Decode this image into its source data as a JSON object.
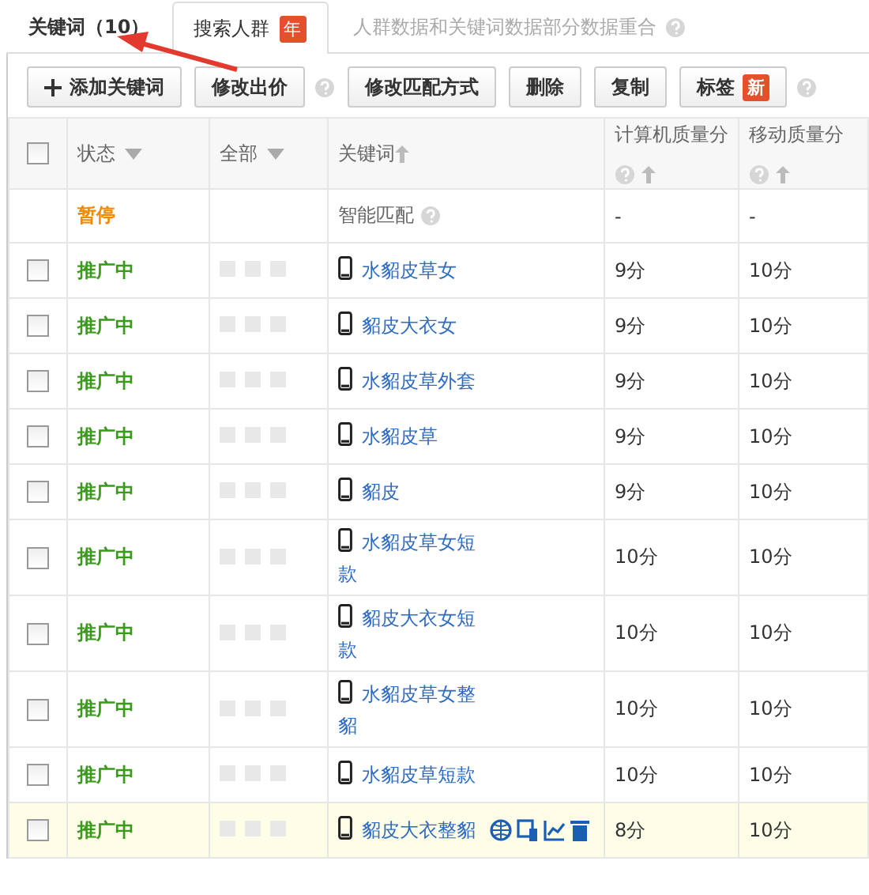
{
  "tabs": [
    {
      "label": "关键词（10）",
      "selected": true
    },
    {
      "label": "搜索人群",
      "badge": "年",
      "selected": false
    }
  ],
  "tab_note": "人群数据和关键词数据部分数据重合",
  "toolbar": [
    {
      "label": "添加关键词",
      "kind": "add",
      "help": false
    },
    {
      "label": "修改出价",
      "kind": "plain",
      "help": true
    },
    {
      "label": "修改匹配方式",
      "kind": "plain",
      "help": false
    },
    {
      "label": "删除",
      "kind": "plain",
      "help": false
    },
    {
      "label": "复制",
      "kind": "plain",
      "help": false
    },
    {
      "label": "标签",
      "kind": "plain",
      "badge": "新",
      "help": true
    }
  ],
  "table": {
    "select_all": {
      "checked": false
    },
    "columns": [
      {
        "label": "状态",
        "kind": "dropdown"
      },
      {
        "label": "全部",
        "kind": "dropdown"
      },
      {
        "label": "关键词",
        "kind": "sort"
      },
      {
        "label": "计算机质量分",
        "kind": "help-sort"
      },
      {
        "label": "移动质量分",
        "kind": "help-sort"
      }
    ],
    "smart_row": {
      "status": "暂停",
      "color": "#f08a00",
      "keyword": "智能匹配",
      "pc_score": "-",
      "mobile_score": "-"
    },
    "rows": [
      {
        "checked": false,
        "status": "推广中",
        "color": "#3a9a1c",
        "keyword": "水貂皮草女",
        "pc_score": "9分",
        "mobile_score": "10分",
        "highlighted": false
      },
      {
        "checked": false,
        "status": "推广中",
        "color": "#3a9a1c",
        "keyword": "貂皮大衣女",
        "pc_score": "9分",
        "mobile_score": "10分",
        "highlighted": false
      },
      {
        "checked": false,
        "status": "推广中",
        "color": "#3a9a1c",
        "keyword": "水貂皮草外套",
        "pc_score": "9分",
        "mobile_score": "10分",
        "highlighted": false
      },
      {
        "checked": false,
        "status": "推广中",
        "color": "#3a9a1c",
        "keyword": "水貂皮草",
        "pc_score": "9分",
        "mobile_score": "10分",
        "highlighted": false
      },
      {
        "checked": false,
        "status": "推广中",
        "color": "#3a9a1c",
        "keyword": "貂皮",
        "pc_score": "9分",
        "mobile_score": "10分",
        "highlighted": false
      },
      {
        "checked": false,
        "status": "推广中",
        "color": "#3a9a1c",
        "keyword": "水貂皮草女短款",
        "pc_score": "10分",
        "mobile_score": "10分",
        "highlighted": false
      },
      {
        "checked": false,
        "status": "推广中",
        "color": "#3a9a1c",
        "keyword": "貂皮大衣女短款",
        "pc_score": "10分",
        "mobile_score": "10分",
        "highlighted": false
      },
      {
        "checked": false,
        "status": "推广中",
        "color": "#3a9a1c",
        "keyword": "水貂皮草女整貂",
        "pc_score": "10分",
        "mobile_score": "10分",
        "highlighted": false
      },
      {
        "checked": false,
        "status": "推广中",
        "color": "#3a9a1c",
        "keyword": "水貂皮草短款",
        "pc_score": "10分",
        "mobile_score": "10分",
        "highlighted": false
      },
      {
        "checked": false,
        "status": "推广中",
        "color": "#3a9a1c",
        "keyword": "貂皮大衣整貂",
        "pc_score": "8分",
        "mobile_score": "10分",
        "highlighted": true
      }
    ]
  }
}
